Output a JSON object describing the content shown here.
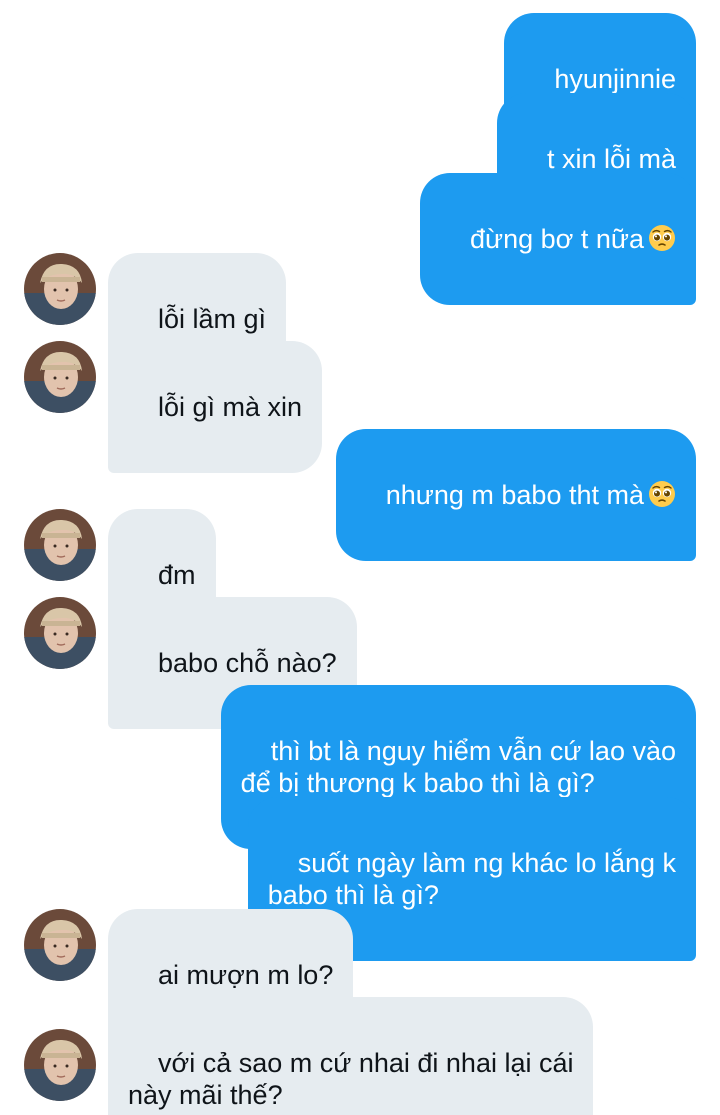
{
  "messages": [
    {
      "sender": "me",
      "text": "hyunjinnie"
    },
    {
      "sender": "me",
      "text": "t xin lỗi mà"
    },
    {
      "sender": "me",
      "text": "đừng bơ t nữa",
      "emoji": "pleading-face-emoji"
    },
    {
      "sender": "them",
      "text": "lỗi lầm gì"
    },
    {
      "sender": "them",
      "text": "lỗi gì mà xin"
    },
    {
      "sender": "me",
      "text": "nhưng m babo tht mà",
      "emoji": "pleading-face-emoji"
    },
    {
      "sender": "them",
      "text": "đm"
    },
    {
      "sender": "them",
      "text": "babo chỗ nào?"
    },
    {
      "sender": "me",
      "text": "thì bt là nguy hiểm vẫn cứ lao vào\nđể bị thương k babo thì là gì?"
    },
    {
      "sender": "me",
      "text": "suốt ngày làm ng khác lo lắng k\nbabo thì là gì?"
    },
    {
      "sender": "them",
      "text": "ai mượn m lo?"
    },
    {
      "sender": "them",
      "text": "với cả sao m cứ nhai đi nhai lại cái\nnày mãi thế?"
    }
  ],
  "colors": {
    "sent_bubble": "#1d9bf0",
    "sent_text": "#ffffff",
    "received_bubble": "#e6ecf0",
    "received_text": "#0f1419",
    "background": "#ffffff"
  },
  "icons": {
    "avatar": "contact-avatar-photo",
    "emoji": "pleading-face-emoji"
  }
}
